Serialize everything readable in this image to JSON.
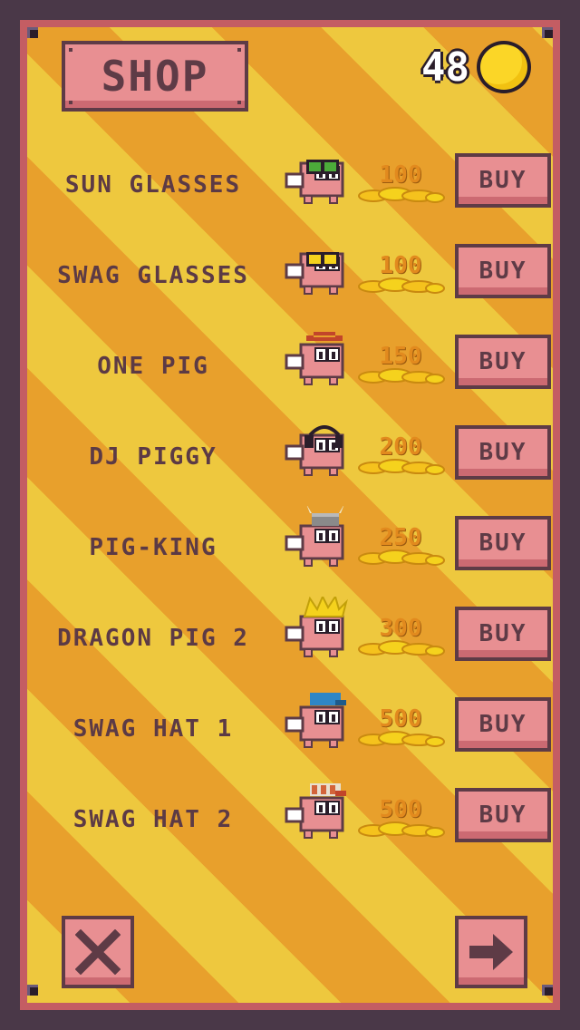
{
  "header": {
    "title": "SHOP",
    "coins": "48"
  },
  "items": [
    {
      "name": "SUN GLASSES",
      "price": "100",
      "buy_label": "BUY",
      "accessory": "sunglasses-green"
    },
    {
      "name": "SWAG GLASSES",
      "price": "100",
      "buy_label": "BUY",
      "accessory": "sunglasses-yellow"
    },
    {
      "name": "ONE PIG",
      "price": "150",
      "buy_label": "BUY",
      "accessory": "straw-hat"
    },
    {
      "name": "DJ PIGGY",
      "price": "200",
      "buy_label": "BUY",
      "accessory": "headphones"
    },
    {
      "name": "PIG-KING",
      "price": "250",
      "buy_label": "BUY",
      "accessory": "viking-helmet"
    },
    {
      "name": "DRAGON PIG 2",
      "price": "300",
      "buy_label": "BUY",
      "accessory": "spiky-hair"
    },
    {
      "name": "SWAG HAT 1",
      "price": "500",
      "buy_label": "BUY",
      "accessory": "blue-cap"
    },
    {
      "name": "SWAG HAT 2",
      "price": "500",
      "buy_label": "BUY",
      "accessory": "striped-cap"
    }
  ],
  "footer": {
    "close_icon": "close-icon",
    "next_icon": "arrow-right-icon"
  },
  "colors": {
    "stripe_light": "#eec83e",
    "stripe_dark": "#e8a02c",
    "button": "#e88f92",
    "text": "#5c3a45",
    "frame": "#c45d63",
    "background": "#4a3848"
  }
}
